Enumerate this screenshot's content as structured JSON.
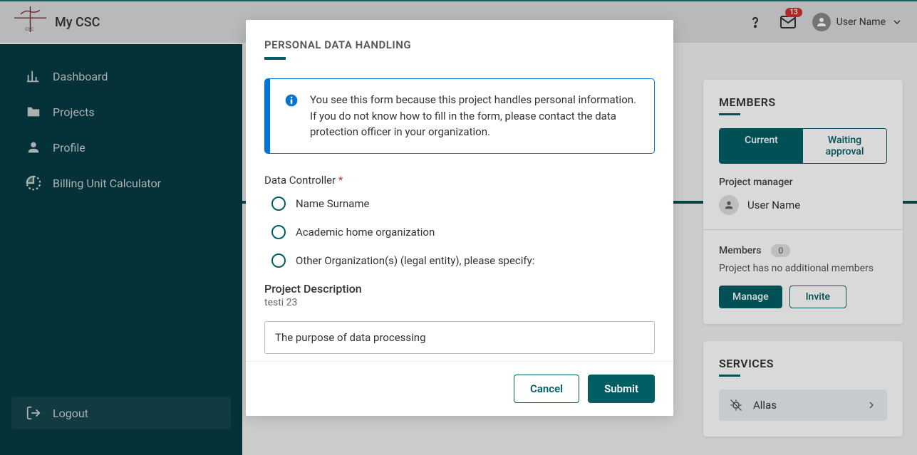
{
  "header": {
    "app_title": "My CSC",
    "notifications_count": "13",
    "username": "User Name"
  },
  "sidebar": {
    "items": [
      {
        "label": "Dashboard"
      },
      {
        "label": "Projects"
      },
      {
        "label": "Profile"
      },
      {
        "label": "Billing Unit Calculator"
      }
    ],
    "logout": "Logout"
  },
  "members_panel": {
    "title": "MEMBERS",
    "tabs": {
      "current": "Current",
      "waiting": "Waiting approval"
    },
    "pm_label": "Project manager",
    "pm_name": "User Name",
    "members_label": "Members",
    "members_count": "0",
    "no_members_text": "Project has no additional members",
    "manage_btn": "Manage",
    "invite_btn": "Invite"
  },
  "services_panel": {
    "title": "SERVICES",
    "items": [
      {
        "name": "Allas"
      }
    ]
  },
  "modal": {
    "title": "PERSONAL DATA HANDLING",
    "info_text": "You see this form because this project handles personal information. If you do not know how to fill in the form, please contact the data protection officer in your organization.",
    "data_controller_label": "Data Controller",
    "radio_options": [
      "Name Surname",
      "Academic home organization",
      "Other Organization(s) (legal entity), please specify:"
    ],
    "project_desc_label": "Project Description",
    "project_desc_subtitle": "testi 23",
    "desc_input_value": "The purpose of data processing",
    "cancel_btn": "Cancel",
    "submit_btn": "Submit"
  }
}
